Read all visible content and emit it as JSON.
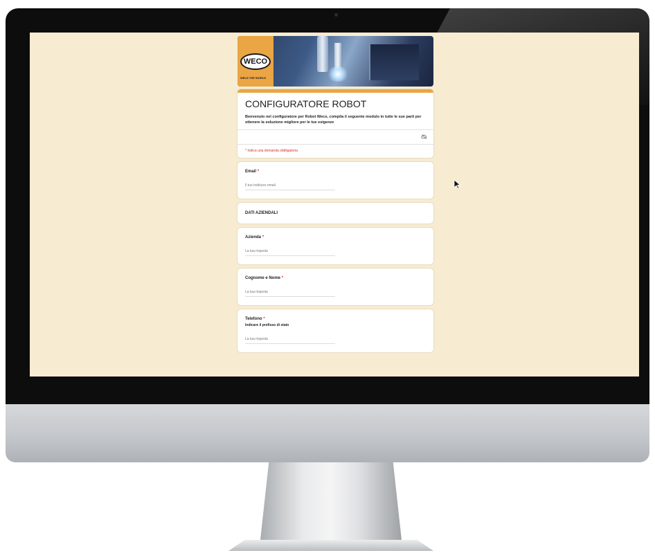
{
  "logo": {
    "brand": "WECO",
    "tagline": "WELD THE WORLD"
  },
  "form": {
    "title": "CONFIGURATORE ROBOT",
    "description": "Benvenuto nel configuratore per Robot Weco, compila il seguente modulo in tutte le sue parti per ottenere la soluzione migliore per le tue esigenze",
    "required_note": "* Indica una domanda obbligatoria",
    "questions": [
      {
        "label": "Email",
        "required_mark": "*",
        "placeholder": "Il tuo indirizzo email"
      },
      {
        "label": "Azienda",
        "required_mark": "*",
        "placeholder": "La tua risposta"
      },
      {
        "label": "Cognome e Nome",
        "required_mark": "*",
        "placeholder": "La tua risposta"
      },
      {
        "label": "Telefono",
        "required_mark": "*",
        "sublabel": "Indicare il prefisso di stato",
        "placeholder": "La tua risposta"
      }
    ],
    "section_title": "DATI AZIENDALI"
  },
  "colors": {
    "screen_bg": "#f7ecd1",
    "accent": "#eaa544",
    "required": "#d93025"
  }
}
